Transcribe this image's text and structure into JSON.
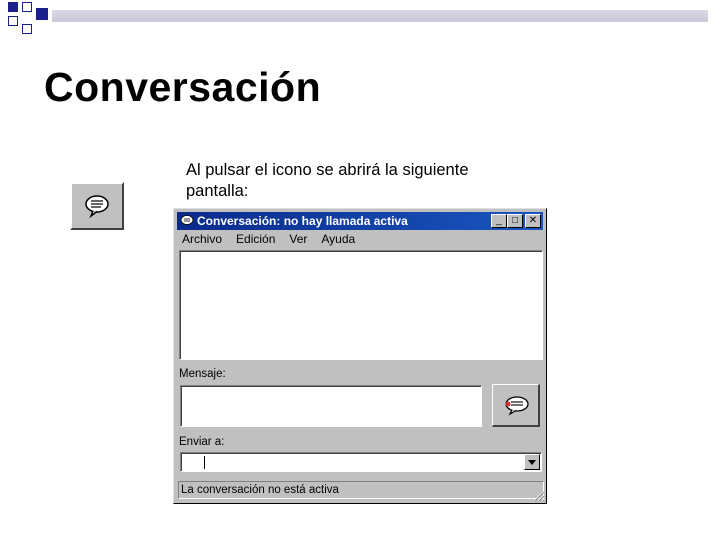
{
  "slide": {
    "title": "Conversación",
    "caption": "Al pulsar el icono se abrirá la siguiente pantalla:"
  },
  "window": {
    "title": "Conversación: no hay llamada activa",
    "controls": {
      "minimize": "_",
      "maximize": "□",
      "close": "✕"
    },
    "menu": [
      "Archivo",
      "Edición",
      "Ver",
      "Ayuda"
    ],
    "message_label": "Mensaje:",
    "send_to_label": "Enviar a:",
    "send_to_value": "",
    "status_text": "La conversación no está activa"
  },
  "icons": {
    "chat_button": "speech-bubble-icon",
    "send_button": "send-message-icon",
    "dropdown": "dropdown-arrow-icon"
  },
  "colors": {
    "accent": "#1b1f8a",
    "titlebar": "#0a2a8a",
    "window_face": "#c0c0c0"
  }
}
